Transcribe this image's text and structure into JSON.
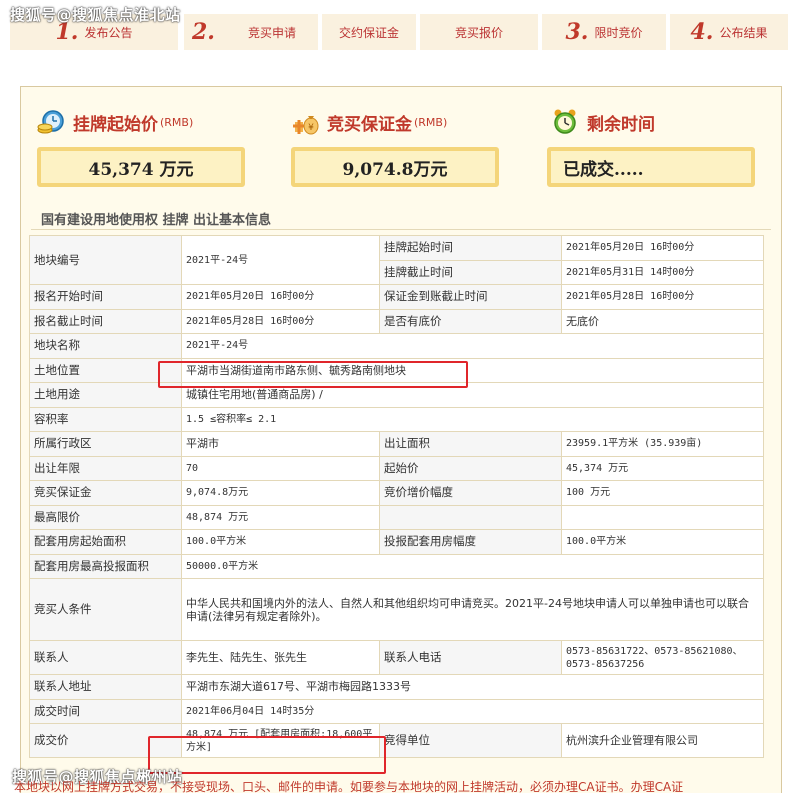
{
  "watermark_top": "搜狐号@搜狐焦点淮北站",
  "watermark_bottom": "搜狐号@搜狐焦点郴州站",
  "steps": [
    {
      "num": "1.",
      "label": "发布公告"
    },
    {
      "num": "2.",
      "label": ""
    },
    {
      "num": "",
      "label": "竞买申请"
    },
    {
      "num": "",
      "label": "交约保证金"
    },
    {
      "num": "",
      "label": "竞买报价"
    },
    {
      "num": "3.",
      "label": "限时竞价"
    },
    {
      "num": "4.",
      "label": "公布结果"
    }
  ],
  "summary": {
    "start_price_title": "挂牌起始价",
    "start_price_unit": "(RMB)",
    "start_price_value": "45,374 万元",
    "deposit_title": "竞买保证金",
    "deposit_unit": "(RMB)",
    "deposit_value": "9,074.8万元",
    "remaining_title": "剩余时间",
    "remaining_value": "已成交....."
  },
  "section_title": "国有建设用地使用权 挂牌 出让基本信息",
  "table": {
    "plot_no_k": "地块编号",
    "plot_no_v": "2021平-24号",
    "listing_start_k": "挂牌起始时间",
    "listing_start_v": "2021年05月20日 16时00分",
    "listing_end_k": "挂牌截止时间",
    "listing_end_v": "2021年05月31日 14时00分",
    "reg_start_k": "报名开始时间",
    "reg_start_v": "2021年05月20日 16时00分",
    "deposit_deadline_k": "保证金到账截止时间",
    "deposit_deadline_v": "2021年05月28日 16时00分",
    "reg_end_k": "报名截止时间",
    "reg_end_v": "2021年05月28日 16时00分",
    "reserve_k": "是否有底价",
    "reserve_v": "无底价",
    "plot_name_k": "地块名称",
    "plot_name_v": "2021平-24号",
    "location_k": "土地位置",
    "location_v": "平湖市当湖街道南市路东侧、毓秀路南侧地块",
    "use_k": "土地用途",
    "use_v": "城镇住宅用地(普通商品房) /",
    "far_k": "容积率",
    "far_v": "1.5 ≤容积率≤ 2.1",
    "district_k": "所属行政区",
    "district_v": "平湖市",
    "area_k": "出让面积",
    "area_v": "23959.1平方米 (35.939亩)",
    "term_k": "出让年限",
    "term_v": "70",
    "start_price_k": "起始价",
    "start_price_v": "45,374 万元",
    "deposit_k": "竞买保证金",
    "deposit_v": "9,074.8万元",
    "increment_k": "竞价增价幅度",
    "increment_v": "100 万元",
    "max_price_k": "最高限价",
    "max_price_v": "48,874 万元",
    "supp_start_k": "配套用房起始面积",
    "supp_start_v": "100.0平方米",
    "supp_step_k": "投报配套用房幅度",
    "supp_step_v": "100.0平方米",
    "supp_max_k": "配套用房最高投报面积",
    "supp_max_v": "50000.0平方米",
    "bidder_k": "竞买人条件",
    "bidder_v": "中华人民共和国境内外的法人、自然人和其他组织均可申请竞买。2021平-24号地块申请人可以单独申请也可以联合申请(法律另有规定者除外)。",
    "contact_k": "联系人",
    "contact_v": "李先生、陆先生、张先生",
    "phone_k": "联系人电话",
    "phone_v": "0573-85631722、0573-85621080、0573-85637256",
    "address_k": "联系人地址",
    "address_v": "平湖市东湖大道617号、平湖市梅园路1333号",
    "deal_time_k": "成交时间",
    "deal_time_v": "2021年06月04日 14时35分",
    "deal_price_k": "成交价",
    "deal_price_v": "48,874 万元 [配套用房面积:18,600平方米]",
    "winner_k": "竞得单位",
    "winner_v": "杭州滨升企业管理有限公司"
  },
  "notice": "本地块以网上挂牌方式交易，不接受现场、口头、邮件的申请。如要参与本地块的网上挂牌活动，必须办理CA证书。办理CA证"
}
